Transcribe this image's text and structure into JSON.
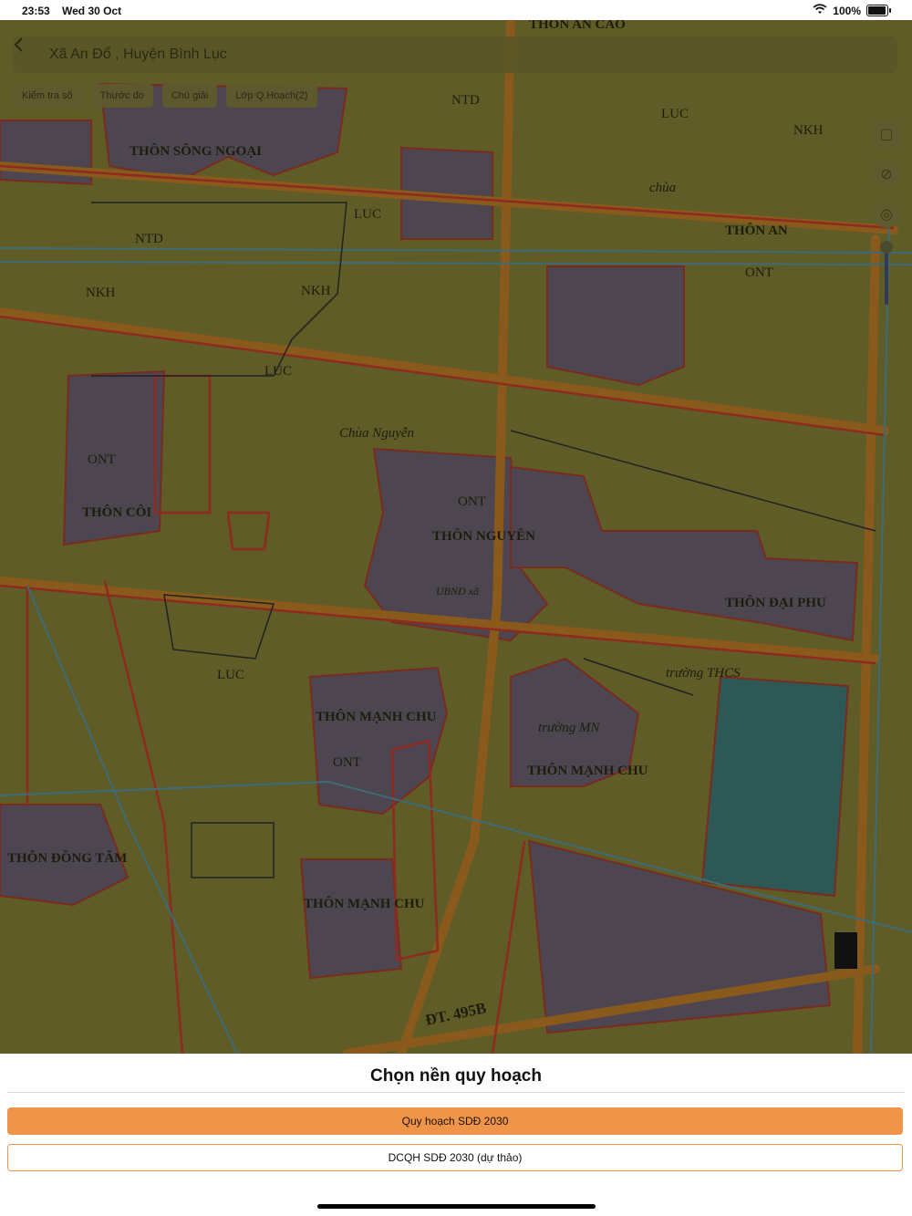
{
  "status": {
    "time": "23:53",
    "date": "Wed 30 Oct",
    "battery": "100%",
    "battery_level": 1.0
  },
  "header": {
    "title": "Xã An Đổ , Huyện Bình Lục",
    "back_icon": "chevron-left-icon"
  },
  "toolbar": {
    "chips": [
      "Kiểm tra số",
      "Thước đo",
      "Chú giải",
      "Lớp Q.Hoạch(2)"
    ]
  },
  "map": {
    "labels": [
      "THÔN SÔNG NGOẠI",
      "THÔN AN CAO",
      "THÔN AN",
      "THÔN CÔI",
      "THÔN NGUYÊN",
      "THÔN ĐẠI PHU",
      "THÔN MẠNH CHU",
      "THÔN MẠNH CHU",
      "THÔN MẠNH CHU",
      "THÔN ĐỒNG TÂM",
      "Chùa Nguyễn",
      "chùa",
      "trường MN",
      "trường THCS",
      "UBND xã",
      "ĐT. 495B",
      "LUC",
      "NTD",
      "NKH",
      "ONT",
      "ONT",
      "ONT",
      "LUC",
      "LUC",
      "NKH",
      "NKH",
      "NTD",
      "LUC",
      "ONT"
    ],
    "colors": {
      "land": "#5f5c28",
      "residential": "#5a4e5a",
      "boundary": "#8f2a1f",
      "road": "#8a5a1c",
      "canal": "#3e6b78"
    }
  },
  "sheet": {
    "title": "Chọn nền quy hoạch",
    "options": [
      "Quy hoạch SDĐ 2030",
      "DCQH SDĐ 2030 (dự thảo)"
    ],
    "accent": "#f0944a"
  }
}
